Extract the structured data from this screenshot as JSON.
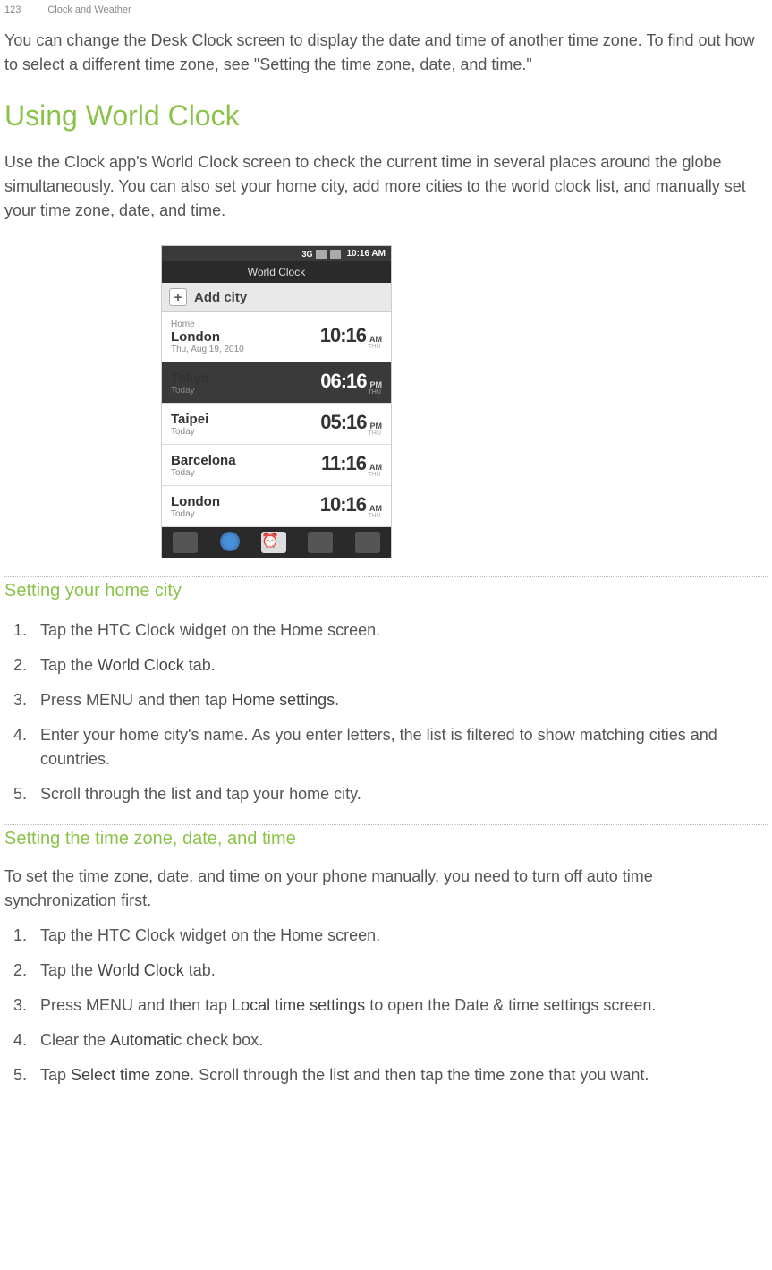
{
  "header": {
    "page_number": "123",
    "section": "Clock and Weather"
  },
  "intro_text": "You can change the Desk Clock screen to display the date and time of another time zone. To find out how to select a different time zone, see \"Setting the time zone, date, and time.\"",
  "main_title": "Using World Clock",
  "main_desc": "Use the Clock app's World Clock screen to check the current time in several places around the globe simultaneously. You can also set your home city, add more cities to the world clock list, and manually set your time zone, date, and time.",
  "screenshot": {
    "status_time": "10:16 AM",
    "3g_label": "3G",
    "title": "World Clock",
    "add_city": "Add city",
    "cities": [
      {
        "label": "Home",
        "name": "London",
        "date": "Thu, Aug 19, 2010",
        "time": "10:16",
        "ampm": "AM",
        "day": "THU",
        "dark": false
      },
      {
        "label": "",
        "name": "Tokyo",
        "date": "Today",
        "time": "06:16",
        "ampm": "PM",
        "day": "THU",
        "dark": true
      },
      {
        "label": "",
        "name": "Taipei",
        "date": "Today",
        "time": "05:16",
        "ampm": "PM",
        "day": "THU",
        "dark": false
      },
      {
        "label": "",
        "name": "Barcelona",
        "date": "Today",
        "time": "11:16",
        "ampm": "AM",
        "day": "THU",
        "dark": false
      },
      {
        "label": "",
        "name": "London",
        "date": "Today",
        "time": "10:16",
        "ampm": "AM",
        "day": "THU",
        "dark": false
      }
    ]
  },
  "section1": {
    "title": "Setting your home city",
    "steps": {
      "s1": "Tap the HTC Clock widget on the Home screen.",
      "s2_a": "Tap the ",
      "s2_b": "World Clock",
      "s2_c": " tab.",
      "s3_a": "Press MENU and then tap ",
      "s3_b": "Home settings",
      "s3_c": ".",
      "s4": "Enter your home city's name. As you enter letters, the list is filtered to show matching cities and countries.",
      "s5": "Scroll through the list and tap your home city."
    }
  },
  "section2": {
    "title": "Setting the time zone, date, and time",
    "intro": "To set the time zone, date, and time on your phone manually, you need to turn off auto time synchronization first.",
    "steps": {
      "s1": "Tap the HTC Clock widget on the Home screen.",
      "s2_a": "Tap the ",
      "s2_b": "World Clock",
      "s2_c": " tab.",
      "s3_a": "Press MENU and then tap ",
      "s3_b": "Local time settings",
      "s3_c": " to open the Date & time settings screen.",
      "s4_a": "Clear the ",
      "s4_b": "Automatic",
      "s4_c": " check box.",
      "s5_a": "Tap ",
      "s5_b": "Select time zone",
      "s5_c": ". Scroll through the list and then tap the time zone that you want."
    }
  }
}
